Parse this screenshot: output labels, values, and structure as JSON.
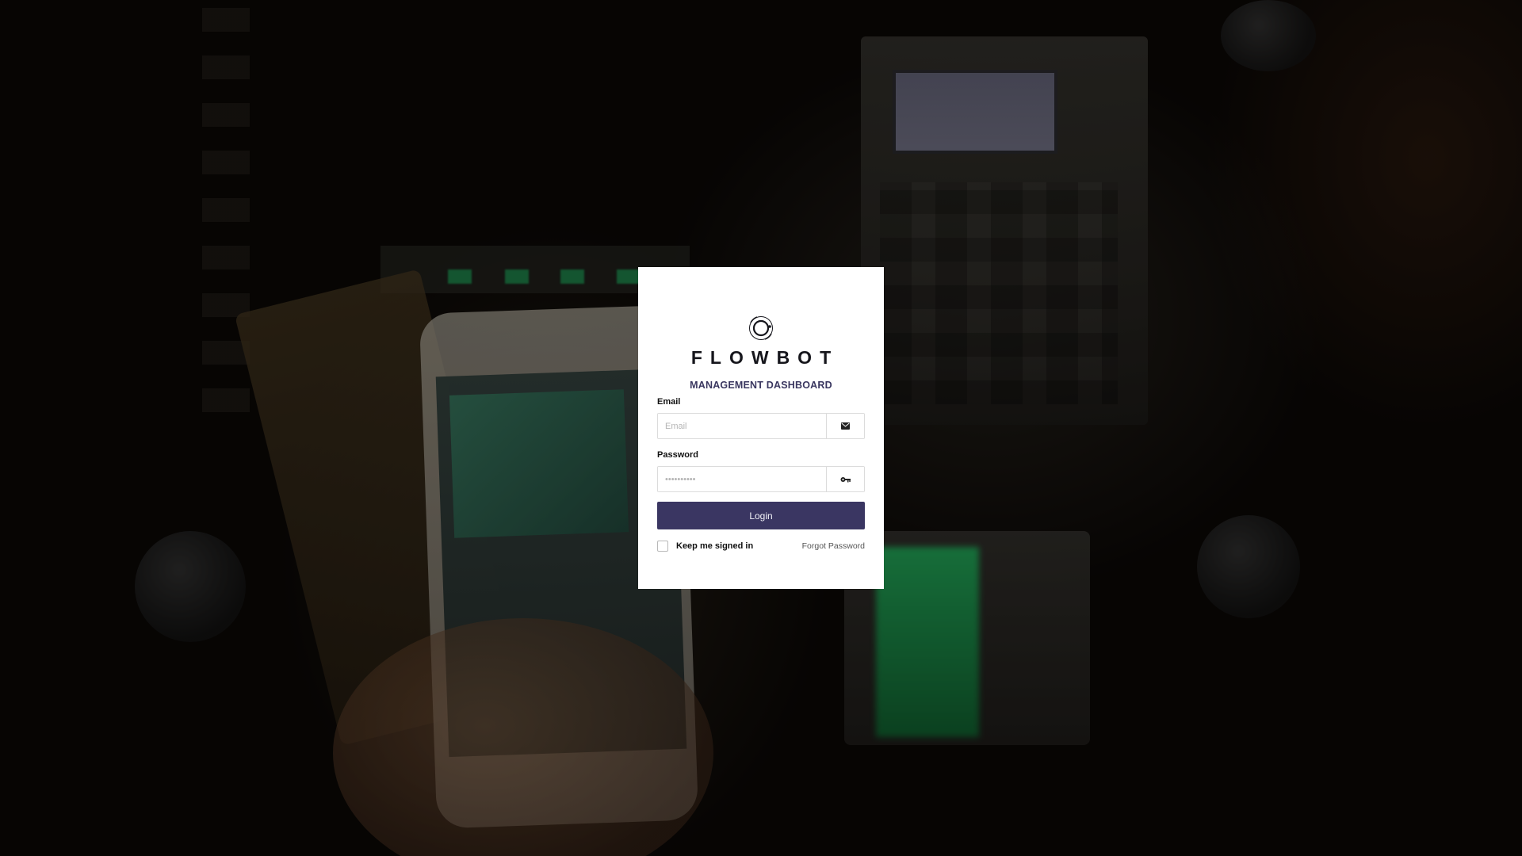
{
  "brand": {
    "name": "FLOWBOT",
    "subtitle": "MANAGEMENT DASHBOARD"
  },
  "form": {
    "email_label": "Email",
    "email_placeholder": "Email",
    "email_value": "",
    "email_icon": "envelope-icon",
    "password_label": "Password",
    "password_placeholder": "••••••••••",
    "password_value": "",
    "password_icon": "key-icon",
    "login_label": "Login",
    "keep_signed_in_label": "Keep me signed in",
    "keep_signed_in_checked": false,
    "forgot_label": "Forgot Password"
  },
  "colors": {
    "primary": "#3a3662",
    "subtitle": "#3a3760",
    "card_bg": "#ffffff",
    "background": "#0b0806"
  }
}
